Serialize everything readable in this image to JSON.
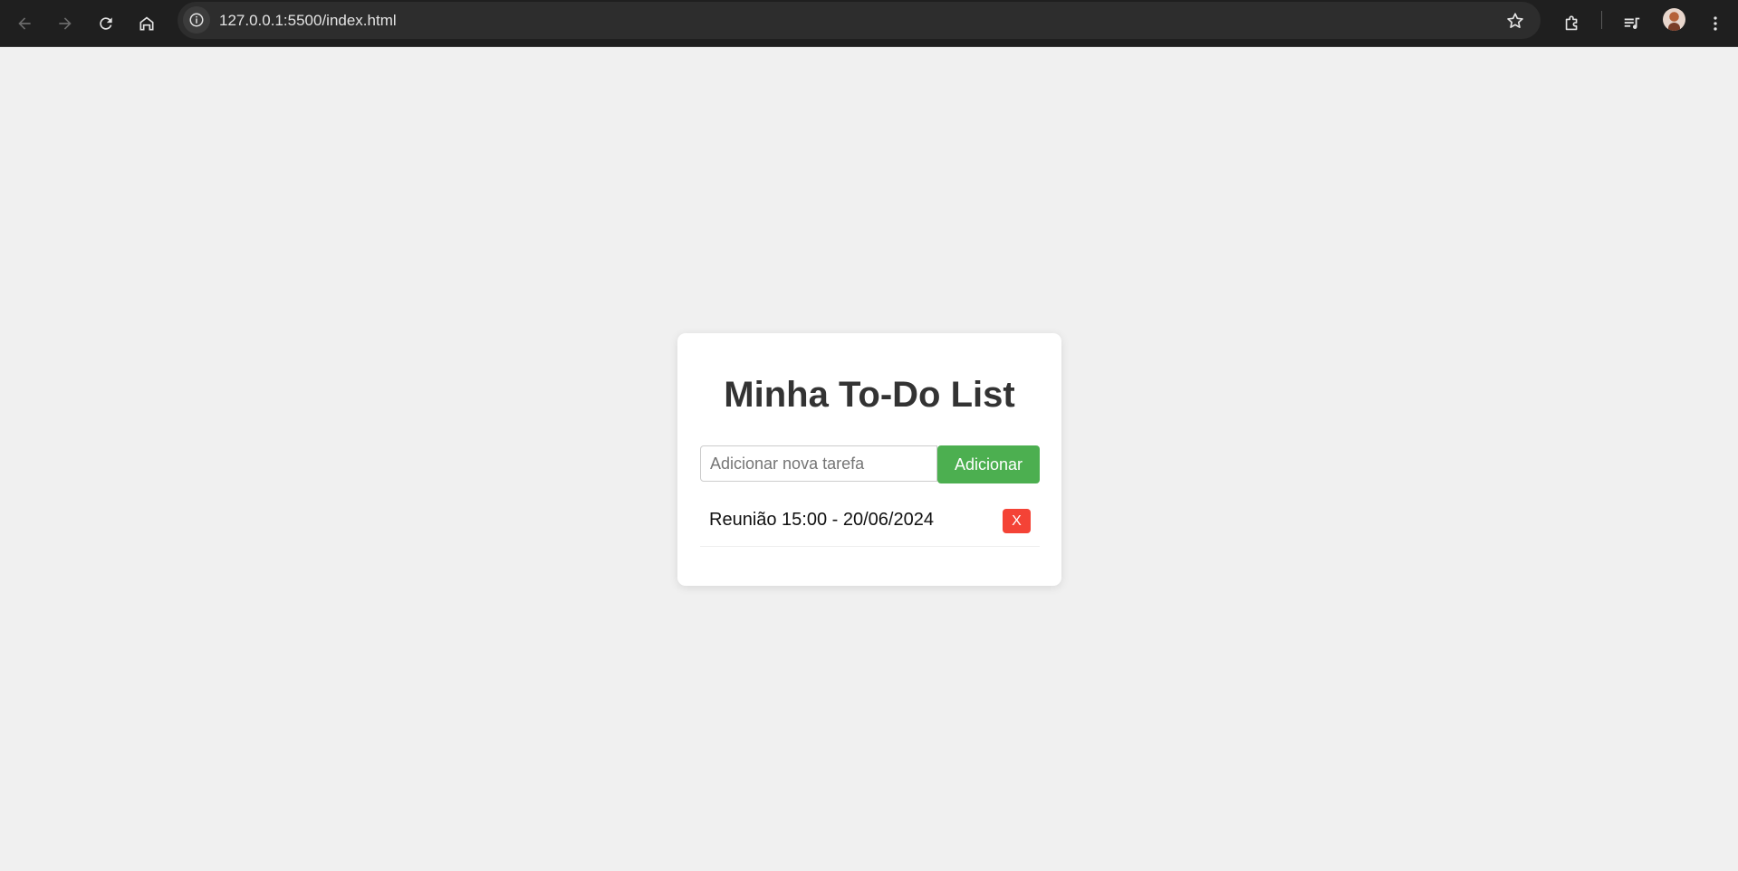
{
  "browser": {
    "url": "127.0.0.1:5500/index.html",
    "icons": {
      "back": "back-arrow-icon",
      "forward": "forward-arrow-icon",
      "reload": "reload-icon",
      "home": "home-icon",
      "site_info": "info-icon",
      "bookmark": "star-icon",
      "extensions": "puzzle-icon",
      "media": "media-queue-icon",
      "profile": "avatar",
      "menu": "kebab-menu-icon"
    }
  },
  "app": {
    "title": "Minha To-Do List",
    "input_placeholder": "Adicionar nova tarefa",
    "input_value": "",
    "add_label": "Adicionar",
    "tasks": [
      {
        "text": "Reunião 15:00 - 20/06/2024",
        "delete_label": "X"
      }
    ]
  },
  "colors": {
    "background": "#f0f0f0",
    "card": "#ffffff",
    "add_button": "#4caf50",
    "delete_button": "#f44336",
    "title": "#333333"
  }
}
